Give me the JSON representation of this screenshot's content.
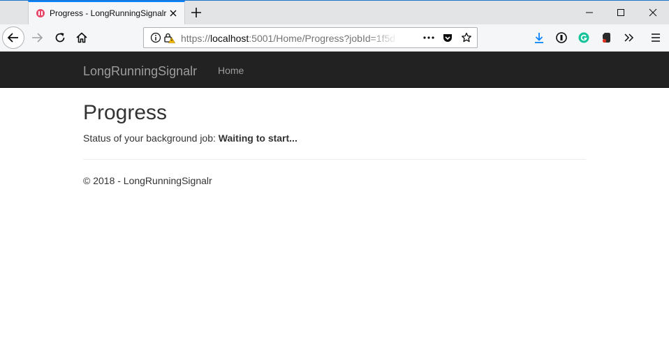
{
  "browser": {
    "tab": {
      "title": "Progress - LongRunningSignalr"
    },
    "url": {
      "scheme": "https://",
      "host": "localhost",
      "rest": ":5001/Home/Progress?jobId=1f5d"
    }
  },
  "site": {
    "brand": "LongRunningSignalr",
    "nav": [
      {
        "label": "Home"
      }
    ]
  },
  "page": {
    "title": "Progress",
    "status_label": "Status of your background job:",
    "status_value": "Waiting to start..."
  },
  "footer": {
    "text": "© 2018 - LongRunningSignalr"
  },
  "colors": {
    "navbar_bg": "#222222",
    "nav_text": "#9d9d9d",
    "tab_accent": "#0a84ff",
    "download_icon": "#0a84ff",
    "grammarly_icon": "#15c39a"
  },
  "icons": [
    "tab-favicon-icon",
    "tab-close-icon",
    "new-tab-icon",
    "minimize-icon",
    "maximize-icon",
    "close-window-icon",
    "back-arrow-icon",
    "forward-arrow-icon",
    "reload-icon",
    "home-icon",
    "info-icon",
    "insecure-lock-icon",
    "page-actions-icon",
    "pocket-icon",
    "bookmark-star-icon",
    "download-icon",
    "extension-icon",
    "grammarly-icon",
    "evernote-icon",
    "overflow-chevrons-icon",
    "menu-icon"
  ]
}
